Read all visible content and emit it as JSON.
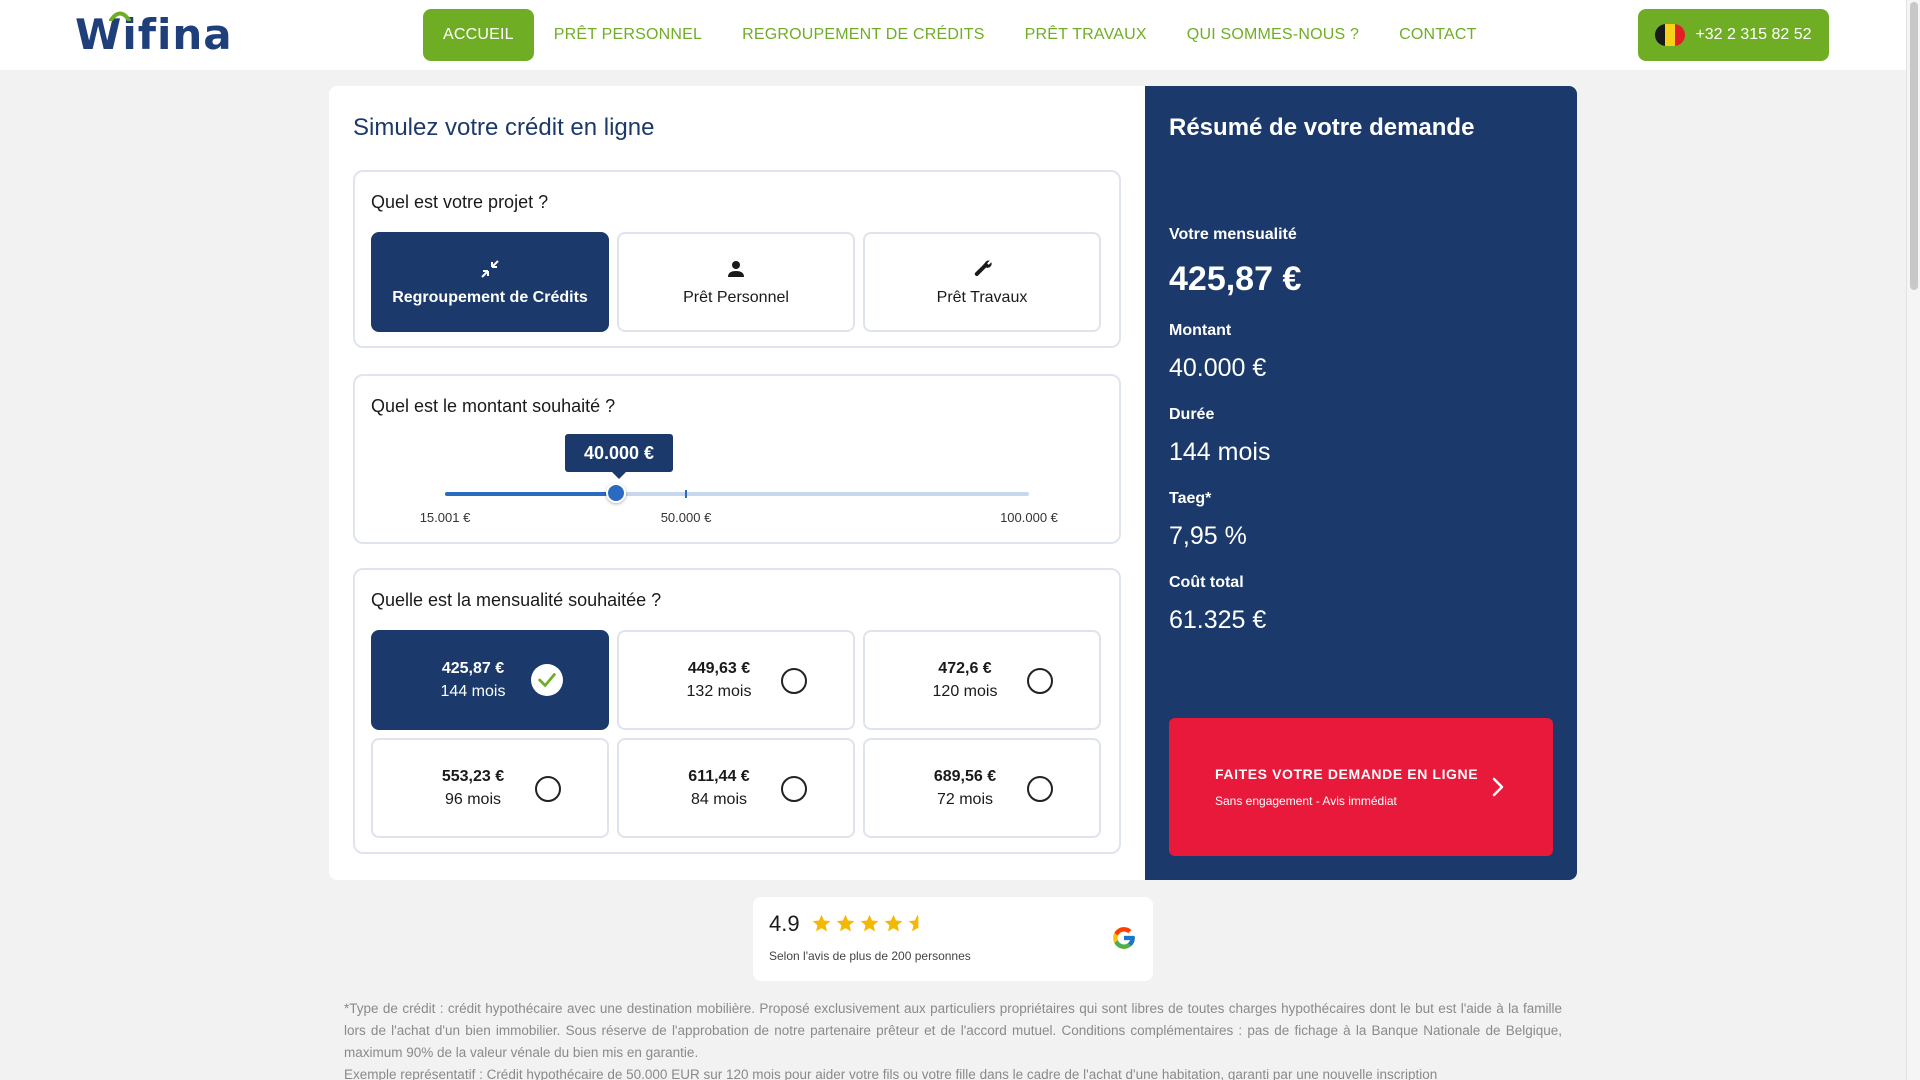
{
  "header": {
    "logo_text": "Wifina",
    "nav": [
      {
        "label": "ACCUEIL",
        "active": true
      },
      {
        "label": "PRÊT PERSONNEL",
        "active": false
      },
      {
        "label": "REGROUPEMENT DE CRÉDITS",
        "active": false
      },
      {
        "label": "PRÊT TRAVAUX",
        "active": false
      },
      {
        "label": "QUI SOMMES-NOUS ?",
        "active": false
      },
      {
        "label": "CONTACT",
        "active": false
      }
    ],
    "phone": "+32 2 315 82 52",
    "phone_flag": "belgium-flag-icon"
  },
  "simulator": {
    "title": "Simulez votre crédit en ligne",
    "project": {
      "question": "Quel est votre projet ?",
      "options": [
        {
          "label": "Regroupement de Crédits",
          "icon": "compress-arrows-icon",
          "selected": true
        },
        {
          "label": "Prêt Personnel",
          "icon": "person-icon",
          "selected": false
        },
        {
          "label": "Prêt Travaux",
          "icon": "wrench-icon",
          "selected": false
        }
      ]
    },
    "amount": {
      "question": "Quel est le montant souhaité ?",
      "value_label": "40.000 €",
      "value": 40000,
      "min_label": "15.001 €",
      "mid_label": "50.000 €",
      "max_label": "100.000 €"
    },
    "monthly": {
      "question": "Quelle est la mensualité souhaitée ?",
      "options": [
        {
          "amount": "425,87 €",
          "months": "144 mois",
          "selected": true
        },
        {
          "amount": "449,63 €",
          "months": "132 mois",
          "selected": false
        },
        {
          "amount": "472,6 €",
          "months": "120 mois",
          "selected": false
        },
        {
          "amount": "553,23 €",
          "months": "96 mois",
          "selected": false
        },
        {
          "amount": "611,44 €",
          "months": "84 mois",
          "selected": false
        },
        {
          "amount": "689,56 €",
          "months": "72 mois",
          "selected": false
        }
      ]
    }
  },
  "summary": {
    "title": "Résumé de votre demande",
    "monthly_label": "Votre mensualité",
    "monthly_value": "425,87 €",
    "amount_label": "Montant",
    "amount_value": "40.000 €",
    "duration_label": "Durée",
    "duration_value": "144 mois",
    "taeg_label": "Taeg*",
    "taeg_value": "7,95 %",
    "cost_label": "Coût total",
    "cost_value": "61.325 €",
    "cta_main": "FAITES VOTRE DEMANDE EN LIGNE",
    "cta_sub": "Sans engagement - Avis immédiat"
  },
  "reviews": {
    "rating": "4.9",
    "stars": 4.9,
    "subtitle": "Selon l'avis de plus de 200 personnes",
    "source_icon": "google-icon"
  },
  "disclaimer": {
    "paragraph1": "*Type de crédit : crédit hypothécaire avec une destination mobilière. Proposé exclusivement aux particuliers propriétaires qui sont libres de toutes charges hypothécaires dont le but est l'aide à la famille lors de l'achat d'un bien immobilier. Sous réserve de l'approbation de notre partenaire prêteur et de l'accord mutuel. Conditions complémentaires : pas de fichage à la Banque Nationale de Belgique, maximum 90% de la valeur vénale du bien mis en garantie.",
    "paragraph2_start": "Exemple représentatif : Crédit hypothécaire de 50.000 EUR sur 120 mois pour aider votre fils ou votre fille dans le cadre de l'achat d'une habitation, garanti par une nouvelle inscription"
  },
  "colors": {
    "brand_green": "#6fae24",
    "navy": "#1b3a6b",
    "cta_red": "#e8193b",
    "slider_blue": "#2a6bc0"
  }
}
